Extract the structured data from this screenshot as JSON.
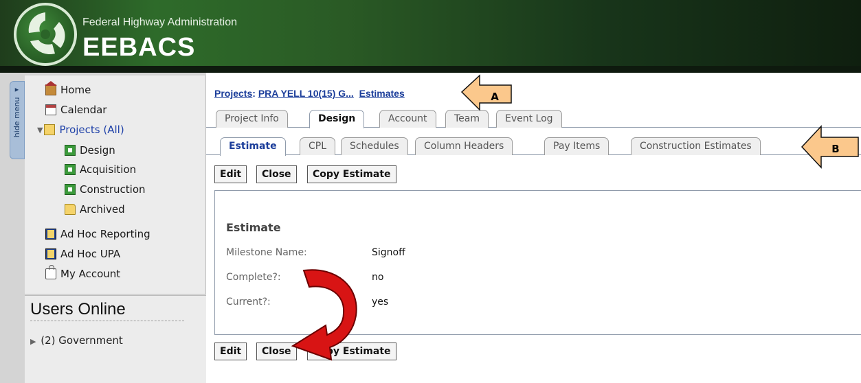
{
  "header": {
    "agency": "Federal Highway Administration",
    "app": "EEBACS"
  },
  "sidebar": {
    "hide_menu": "hide menu ◂",
    "items": [
      {
        "label": "Home",
        "icon": "home-icon"
      },
      {
        "label": "Calendar",
        "icon": "calendar-icon"
      },
      {
        "label": "Projects (All)",
        "icon": "folder-open-icon"
      },
      {
        "label": "Design",
        "icon": "green-folder-icon"
      },
      {
        "label": "Acquisition",
        "icon": "green-folder-icon"
      },
      {
        "label": "Construction",
        "icon": "green-folder-icon"
      },
      {
        "label": "Archived",
        "icon": "folder-icon"
      },
      {
        "label": "Ad Hoc Reporting",
        "icon": "report-icon"
      },
      {
        "label": "Ad Hoc UPA",
        "icon": "report-icon"
      },
      {
        "label": "My Account",
        "icon": "lock-icon"
      }
    ],
    "users_online": {
      "title": "Users Online",
      "government": "(2) Government"
    }
  },
  "breadcrumb": {
    "projects": "Projects",
    "separator": ":",
    "project": "PRA YELL 10(15) G...",
    "page": "Estimates"
  },
  "tabs": [
    "Project Info",
    "Design",
    "Account",
    "Team",
    "Event Log"
  ],
  "subtabs": [
    "Estimate",
    "CPL",
    "Schedules",
    "Column Headers",
    "Pay Items",
    "Construction Estimates"
  ],
  "buttons": {
    "edit": "Edit",
    "close": "Close",
    "copy": "Copy Estimate"
  },
  "estimate": {
    "title": "Estimate",
    "fields": [
      {
        "label": "Milestone Name:",
        "value": "Signoff"
      },
      {
        "label": "Complete?:",
        "value": "no"
      },
      {
        "label": "Current?:",
        "value": "yes"
      }
    ]
  },
  "callouts": {
    "a": "A",
    "b": "B"
  },
  "colors": {
    "link": "#1b3d9a",
    "callout": "#fbc88c",
    "arrow": "#d81414"
  }
}
